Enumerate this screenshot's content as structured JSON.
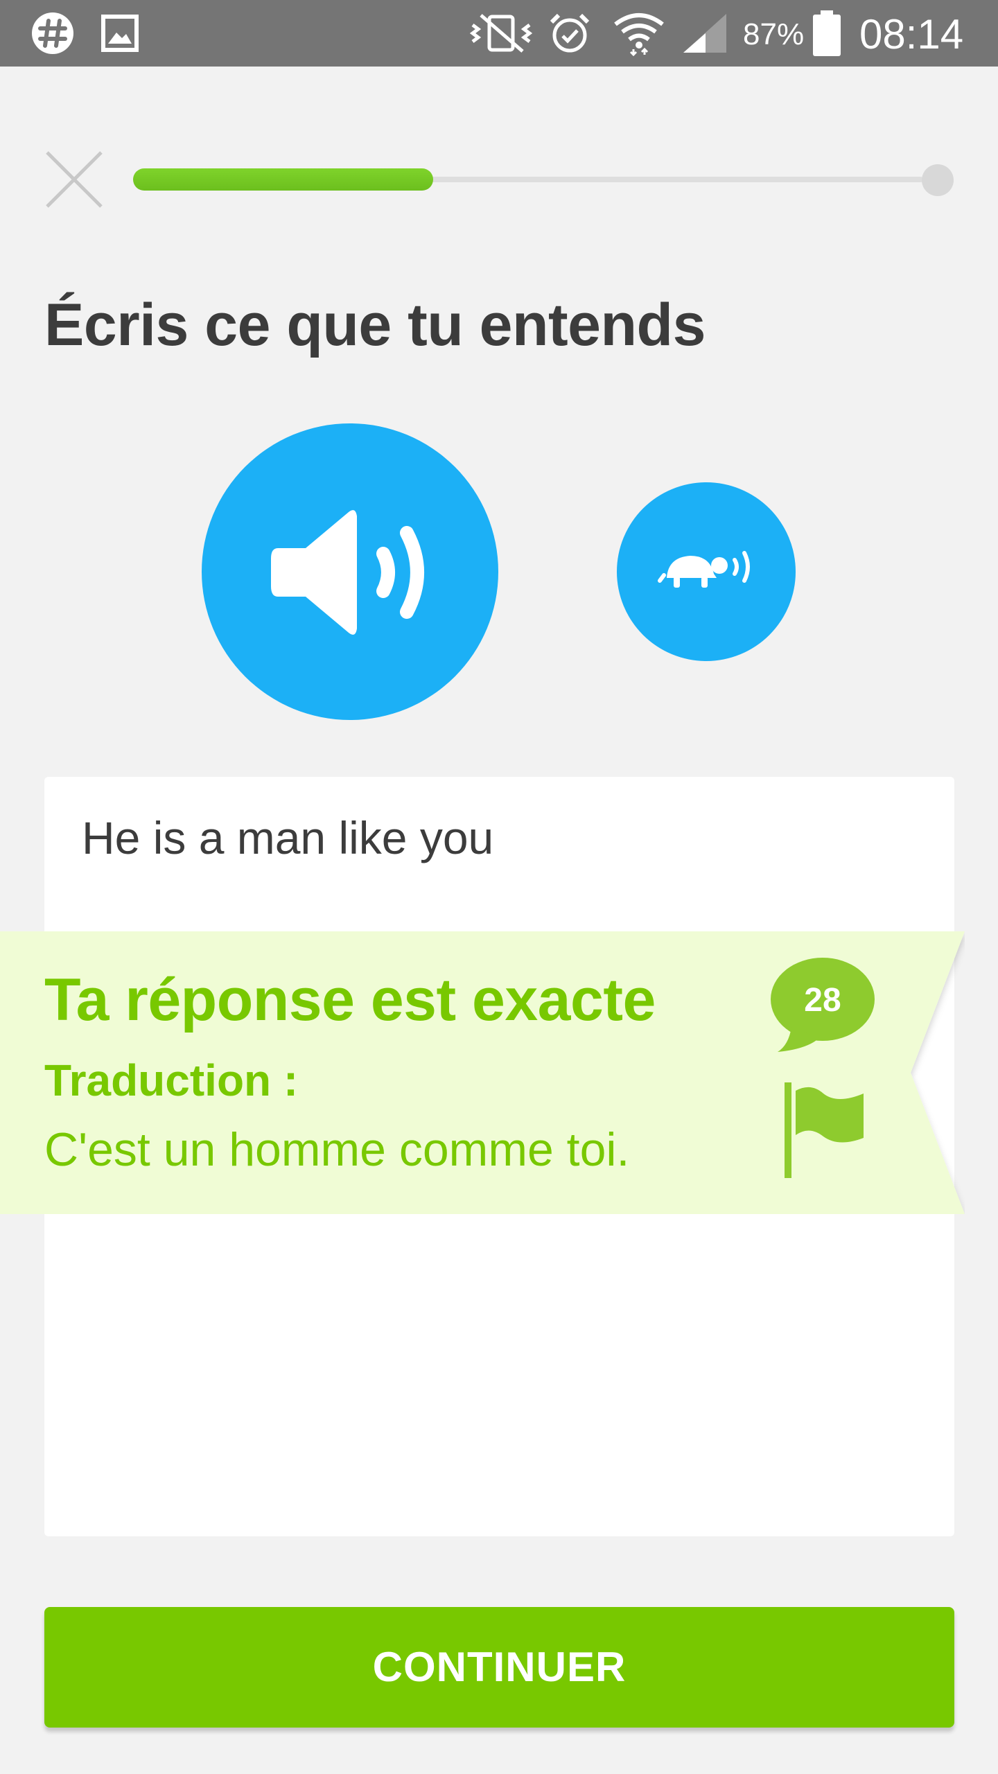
{
  "status_bar": {
    "battery_percent": "87%",
    "time": "08:14",
    "icons": [
      "slack-icon",
      "gallery-icon",
      "mute-vibrate-icon",
      "alarm-icon",
      "wifi-icon",
      "cell-signal-icon",
      "battery-icon"
    ]
  },
  "lesson": {
    "progress": 0.38,
    "close_icon": "close-icon"
  },
  "challenge": {
    "prompt": "Écris ce que tu entends",
    "audio_icon": "speaker-icon",
    "slow_audio_icon": "turtle-icon",
    "answer": "He is a man like you"
  },
  "feedback": {
    "title": "Ta réponse est exacte",
    "translation_label": "Traduction :",
    "translation": "C'est un homme comme toi.",
    "comment_count": "28",
    "flag_icon": "flag-icon"
  },
  "footer": {
    "continue_label": "CONTINUER"
  },
  "colors": {
    "status_bar": "#757575",
    "background": "#f2f2f2",
    "accent_blue": "#1cb0f6",
    "accent_green": "#78c800",
    "banner_bg": "#f0fcd5",
    "text_dark": "#3c3c3c"
  }
}
